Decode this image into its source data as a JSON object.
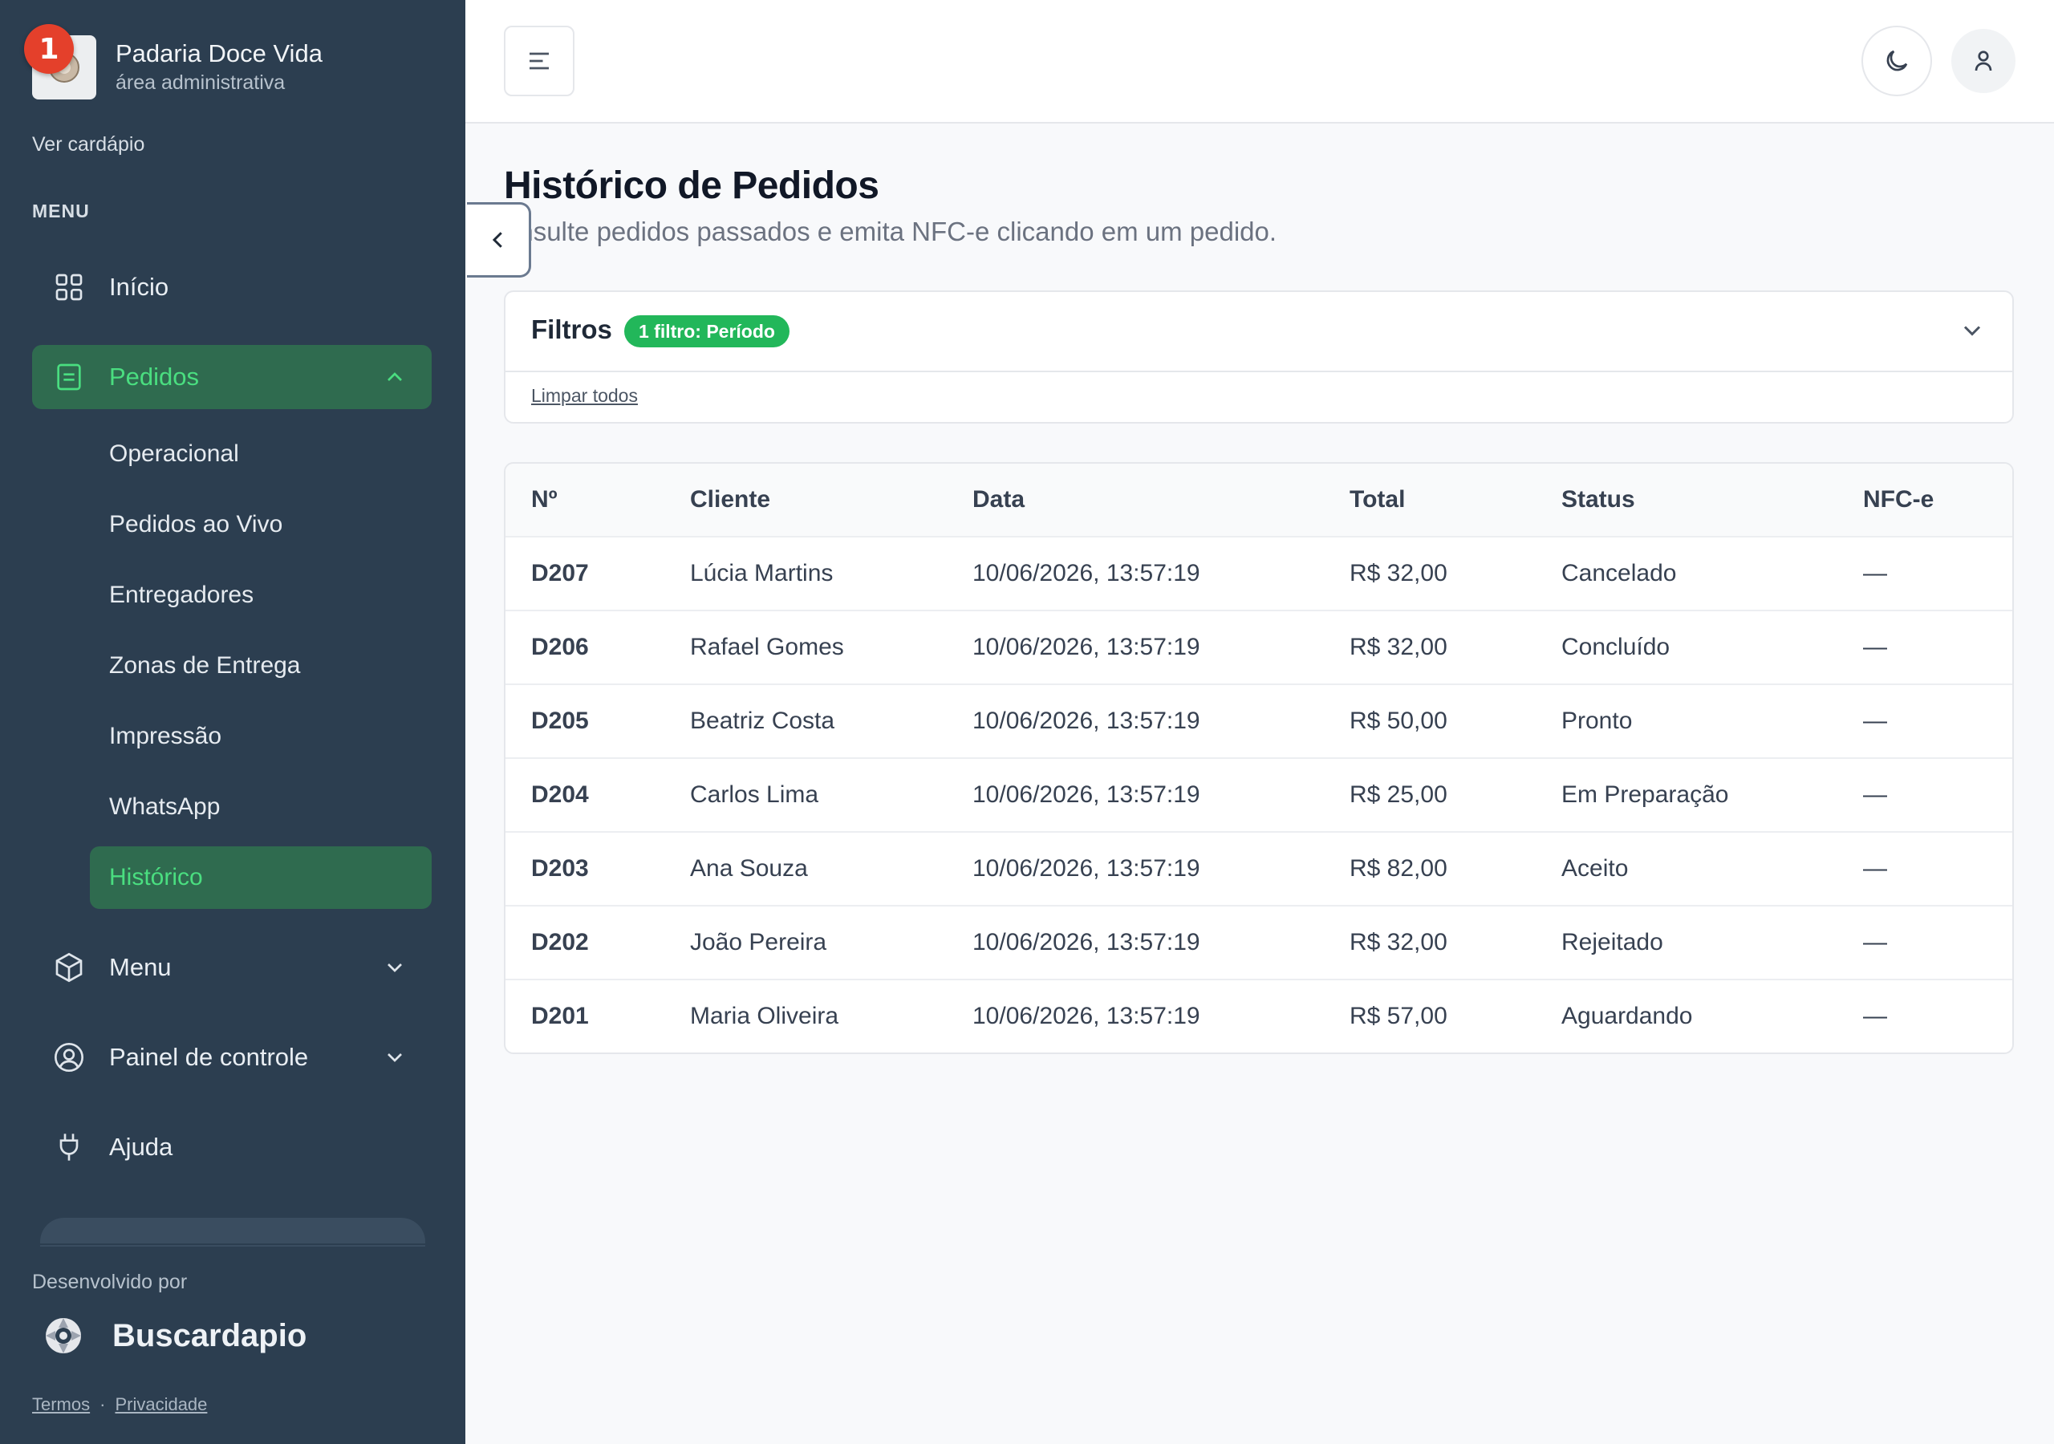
{
  "brand": {
    "name": "Padaria Doce Vida",
    "subtitle": "área administrativa",
    "notification_count": "1"
  },
  "sidebar": {
    "view_menu_link": "Ver cardápio",
    "menu_heading": "MENU",
    "items": [
      {
        "label": "Início",
        "icon": "grid-icon"
      },
      {
        "label": "Pedidos",
        "icon": "list-icon",
        "expanded": true
      },
      {
        "label": "Menu",
        "icon": "box-icon"
      },
      {
        "label": "Painel de controle",
        "icon": "user-circle-icon"
      },
      {
        "label": "Ajuda",
        "icon": "plug-icon"
      }
    ],
    "pedidos_subitems": [
      "Operacional",
      "Pedidos ao Vivo",
      "Entregadores",
      "Zonas de Entrega",
      "Impressão",
      "WhatsApp",
      "Histórico"
    ],
    "active_subitem": "Histórico",
    "developed_by": "Desenvolvido por",
    "developer_name": "Buscardapio",
    "legal": {
      "terms": "Termos",
      "separator": "·",
      "privacy": "Privacidade"
    }
  },
  "page": {
    "title": "Histórico de Pedidos",
    "description": "onsulte pedidos passados e emita NFC-e clicando em um pedido."
  },
  "filters": {
    "title": "Filtros",
    "badge": "1 filtro: Período",
    "clear_all": "Limpar todos"
  },
  "table": {
    "columns": [
      "Nº",
      "Cliente",
      "Data",
      "Total",
      "Status",
      "NFC-e"
    ],
    "rows": [
      [
        "D207",
        "Lúcia Martins",
        "10/06/2026, 13:57:19",
        "R$ 32,00",
        "Cancelado",
        "—"
      ],
      [
        "D206",
        "Rafael Gomes",
        "10/06/2026, 13:57:19",
        "R$ 32,00",
        "Concluído",
        "—"
      ],
      [
        "D205",
        "Beatriz Costa",
        "10/06/2026, 13:57:19",
        "R$ 50,00",
        "Pronto",
        "—"
      ],
      [
        "D204",
        "Carlos Lima",
        "10/06/2026, 13:57:19",
        "R$ 25,00",
        "Em Preparação",
        "—"
      ],
      [
        "D203",
        "Ana Souza",
        "10/06/2026, 13:57:19",
        "R$ 82,00",
        "Aceito",
        "—"
      ],
      [
        "D202",
        "João Pereira",
        "10/06/2026, 13:57:19",
        "R$ 32,00",
        "Rejeitado",
        "—"
      ],
      [
        "D201",
        "Maria Oliveira",
        "10/06/2026, 13:57:19",
        "R$ 57,00",
        "Aguardando",
        "—"
      ]
    ]
  },
  "colors": {
    "sidebar_bg": "#2c3e50",
    "active_bg": "#2f6b4f",
    "active_text": "#4ade80",
    "badge_green": "#22b75a",
    "notification_red": "#e4402b"
  }
}
